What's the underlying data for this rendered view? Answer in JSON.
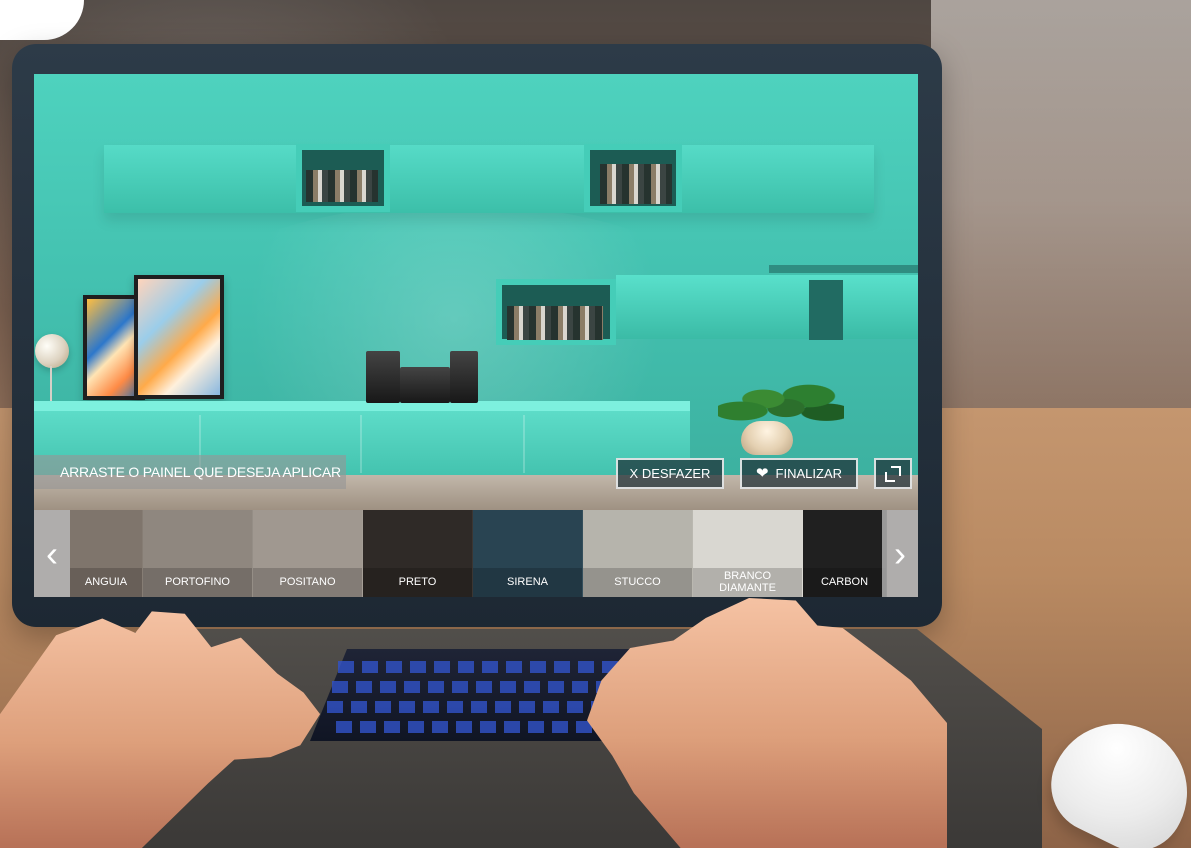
{
  "screen": {
    "hint": "ARRASTE O PAINEL QUE DESEJA APLICAR",
    "actions": {
      "undo": "X DESFAZER",
      "finish": "FINALIZAR",
      "expand_icon": "expand-icon",
      "heart_icon": "heart-icon"
    },
    "carousel": {
      "left_arrow_icon": "chevron-left-icon",
      "right_arrow_icon": "chevron-right-icon",
      "items": [
        {
          "label": "ANGUIA",
          "color": "#7f756c"
        },
        {
          "label": "PORTOFINO",
          "color": "#8f877f"
        },
        {
          "label": "POSITANO",
          "color": "#a09890"
        },
        {
          "label": "PRETO",
          "color": "#2f2a27"
        },
        {
          "label": "SIRENA",
          "color": "#294452"
        },
        {
          "label": "STUCCO",
          "color": "#b6b4ac"
        },
        {
          "label": "BRANCO DIAMANTE",
          "color": "#d9d7d1"
        },
        {
          "label": "CARBON",
          "color": "#202020"
        }
      ]
    }
  }
}
